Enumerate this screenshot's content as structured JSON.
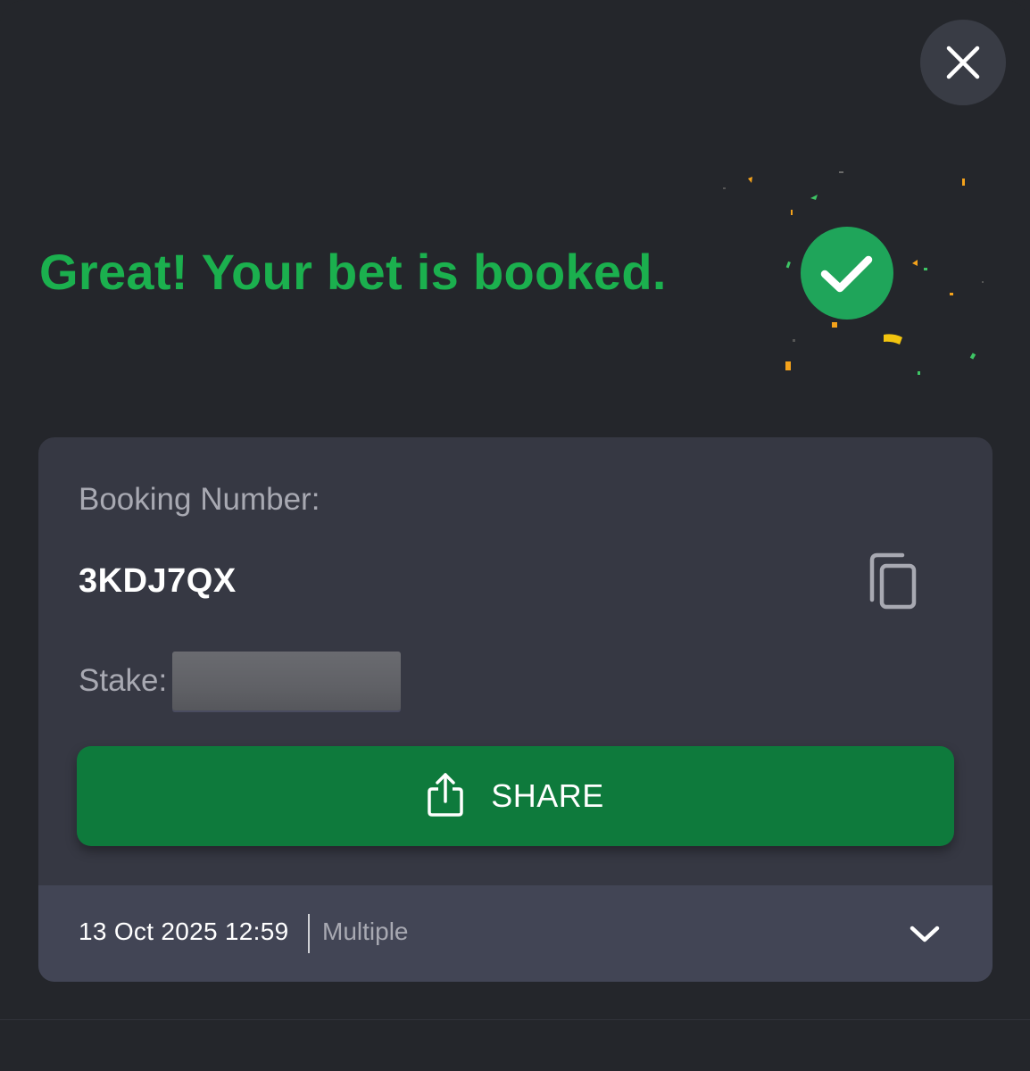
{
  "dialog": {
    "headline": "Great! Your bet is booked.",
    "close_icon": "close-icon",
    "success_icon": "check-circle-icon"
  },
  "booking": {
    "number_label": "Booking Number:",
    "number_value": "3KDJ7QX",
    "copy_icon": "copy-icon",
    "stake_label": "Stake:",
    "stake_value": ""
  },
  "share": {
    "label": "SHARE",
    "icon": "share-icon"
  },
  "footer": {
    "date": "13 Oct 2025 12:59",
    "bet_type": "Multiple",
    "expand_icon": "chevron-down-icon"
  },
  "colors": {
    "background": "#24262b",
    "card": "#363843",
    "footer": "#424555",
    "accent_green": "#1bb04e",
    "button_green": "#0e7a3c",
    "muted_text": "#a8a9b2"
  }
}
